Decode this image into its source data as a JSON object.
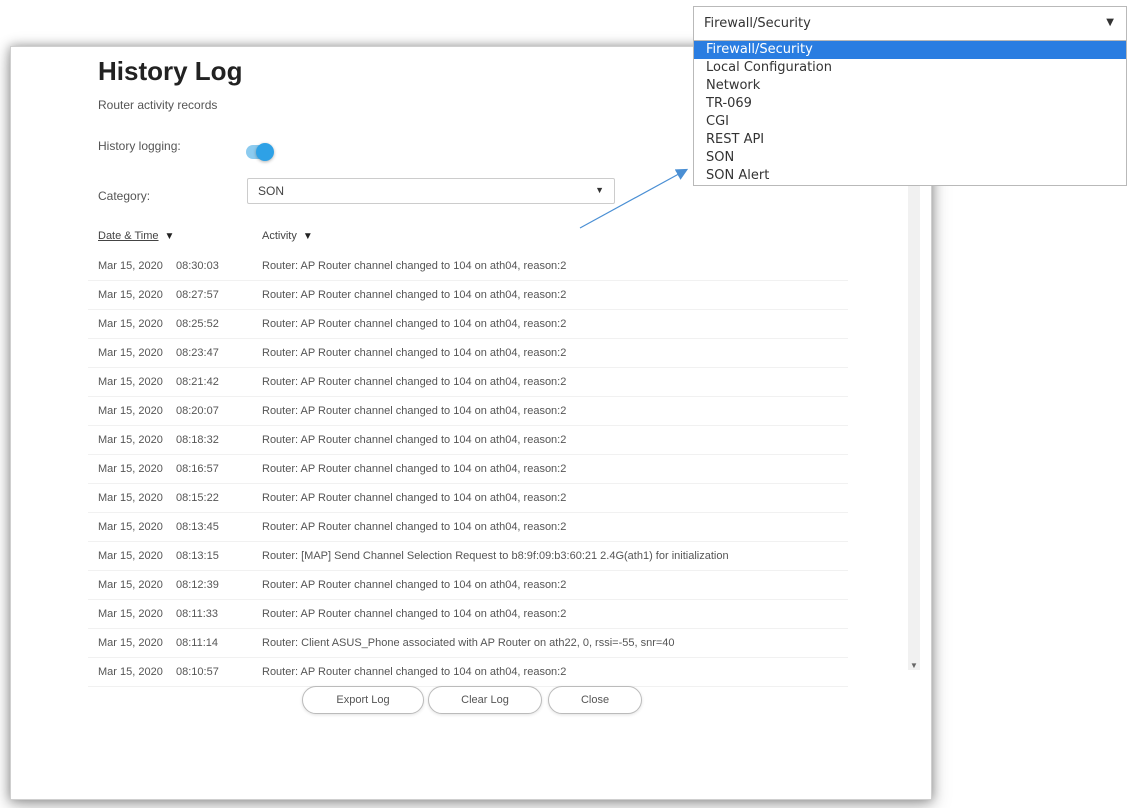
{
  "dialog": {
    "title": "History Log",
    "subtitle": "Router activity records",
    "logging_label": "History logging:",
    "logging_enabled": true,
    "category_label": "Category:",
    "category_value": "SON",
    "columns": {
      "date": "Date & Time",
      "activity": "Activity"
    },
    "rows": [
      {
        "date": "Mar 15, 2020",
        "time": "08:30:03",
        "activity": "Router: AP Router channel changed to 104 on ath04, reason:2"
      },
      {
        "date": "Mar 15, 2020",
        "time": "08:27:57",
        "activity": "Router: AP Router channel changed to 104 on ath04, reason:2"
      },
      {
        "date": "Mar 15, 2020",
        "time": "08:25:52",
        "activity": "Router: AP Router channel changed to 104 on ath04, reason:2"
      },
      {
        "date": "Mar 15, 2020",
        "time": "08:23:47",
        "activity": "Router: AP Router channel changed to 104 on ath04, reason:2"
      },
      {
        "date": "Mar 15, 2020",
        "time": "08:21:42",
        "activity": "Router: AP Router channel changed to 104 on ath04, reason:2"
      },
      {
        "date": "Mar 15, 2020",
        "time": "08:20:07",
        "activity": "Router: AP Router channel changed to 104 on ath04, reason:2"
      },
      {
        "date": "Mar 15, 2020",
        "time": "08:18:32",
        "activity": "Router: AP Router channel changed to 104 on ath04, reason:2"
      },
      {
        "date": "Mar 15, 2020",
        "time": "08:16:57",
        "activity": "Router: AP Router channel changed to 104 on ath04, reason:2"
      },
      {
        "date": "Mar 15, 2020",
        "time": "08:15:22",
        "activity": "Router: AP Router channel changed to 104 on ath04, reason:2"
      },
      {
        "date": "Mar 15, 2020",
        "time": "08:13:45",
        "activity": "Router: AP Router channel changed to 104 on ath04, reason:2"
      },
      {
        "date": "Mar 15, 2020",
        "time": "08:13:15",
        "activity": "Router: [MAP] Send Channel Selection Request to b8:9f:09:b3:60:21 2.4G(ath1) for initialization"
      },
      {
        "date": "Mar 15, 2020",
        "time": "08:12:39",
        "activity": "Router: AP Router channel changed to 104 on ath04, reason:2"
      },
      {
        "date": "Mar 15, 2020",
        "time": "08:11:33",
        "activity": "Router: AP Router channel changed to 104 on ath04, reason:2"
      },
      {
        "date": "Mar 15, 2020",
        "time": "08:11:14",
        "activity": "Router: Client ASUS_Phone associated with AP Router on ath22, 0, rssi=-55, snr=40"
      },
      {
        "date": "Mar 15, 2020",
        "time": "08:10:57",
        "activity": "Router: AP Router channel changed to 104 on ath04, reason:2"
      }
    ],
    "buttons": {
      "export": "Export Log",
      "clear": "Clear Log",
      "close": "Close"
    }
  },
  "dropdown": {
    "selected": "Firewall/Security",
    "options": [
      "Firewall/Security",
      "Local Configuration",
      "Network",
      "TR-069",
      "CGI",
      "REST API",
      "SON",
      "SON Alert"
    ]
  },
  "colors": {
    "toggle": "#2ea1e6",
    "dropdown_highlight": "#2a7de1",
    "callout_arrow": "#4a8fd4"
  },
  "icons": {
    "sort": "caret-down-icon",
    "select": "chevron-down-icon"
  }
}
